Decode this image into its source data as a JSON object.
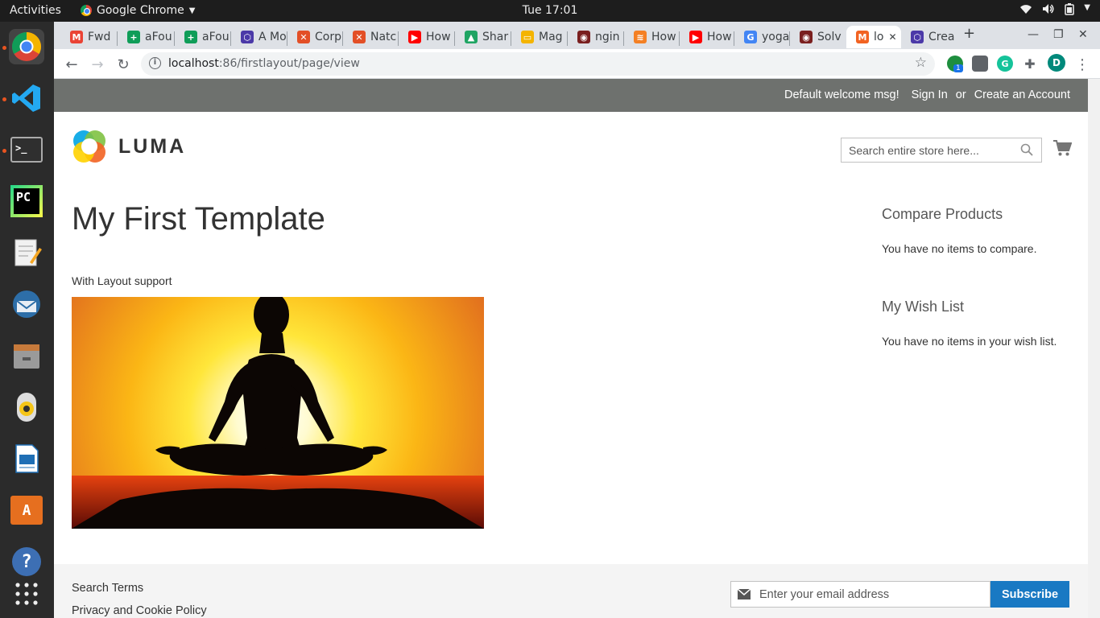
{
  "system": {
    "activities": "Activities",
    "app_name": "Google Chrome",
    "clock": "Tue 17:01"
  },
  "dock": [
    {
      "name": "chrome",
      "label": "",
      "color": "#4285f4"
    },
    {
      "name": "vscode",
      "label": "",
      "color": "#23a9f2"
    },
    {
      "name": "terminal",
      "label": ">_",
      "color": "#2f2f2f"
    },
    {
      "name": "pycharm",
      "label": "PC",
      "color": "#21d789"
    },
    {
      "name": "text-editor",
      "label": "",
      "color": "#f1f1f1"
    },
    {
      "name": "thunderbird",
      "label": "",
      "color": "#2d6ea8"
    },
    {
      "name": "files",
      "label": "",
      "color": "#9a9a9a"
    },
    {
      "name": "rhythmbox",
      "label": "",
      "color": "#f5c518"
    },
    {
      "name": "writer",
      "label": "",
      "color": "#1f6fb5"
    },
    {
      "name": "software",
      "label": "A",
      "color": "#e66f1f"
    },
    {
      "name": "help",
      "label": "?",
      "color": "#3d6fb4"
    }
  ],
  "tabs": [
    {
      "title": "Fwd",
      "fav": "M",
      "color": "#ea4335"
    },
    {
      "title": "aFou",
      "fav": "+",
      "color": "#0f9d58"
    },
    {
      "title": "aFou",
      "fav": "+",
      "color": "#0f9d58"
    },
    {
      "title": "A Mo",
      "fav": "⬡",
      "color": "#4b39a8"
    },
    {
      "title": "Corp",
      "fav": "✕",
      "color": "#e34f26"
    },
    {
      "title": "Natc",
      "fav": "✕",
      "color": "#e34f26"
    },
    {
      "title": "How",
      "fav": "▶",
      "color": "#ff0000"
    },
    {
      "title": "Shar",
      "fav": "▲",
      "color": "#1fa463"
    },
    {
      "title": "Mag",
      "fav": "▭",
      "color": "#f4b400"
    },
    {
      "title": "ngin",
      "fav": "◉",
      "color": "#7a1f1f"
    },
    {
      "title": "How",
      "fav": "≋",
      "color": "#f48024"
    },
    {
      "title": "How",
      "fav": "▶",
      "color": "#ff0000"
    },
    {
      "title": "yoga",
      "fav": "G",
      "color": "#4285f4"
    },
    {
      "title": "Solv",
      "fav": "◉",
      "color": "#7a1f1f"
    },
    {
      "title": "lo",
      "fav": "M",
      "color": "#f26322"
    },
    {
      "title": "Crea",
      "fav": "⬡",
      "color": "#4b39a8"
    }
  ],
  "toolbar": {
    "url_host": "localhost",
    "url_rest": ":86/firstlayout/page/view",
    "profile_initial": "D",
    "ext_badge": "1"
  },
  "header": {
    "welcome": "Default welcome msg!",
    "sign_in": "Sign In",
    "or": "or",
    "create_account": "Create an Account",
    "logo_text": "LUMA",
    "search_placeholder": "Search entire store here..."
  },
  "main": {
    "title": "My First Template",
    "subtitle": "With Layout support"
  },
  "sidebar": {
    "compare_title": "Compare Products",
    "compare_text": "You have no items to compare.",
    "wishlist_title": "My Wish List",
    "wishlist_text": "You have no items in your wish list."
  },
  "footer": {
    "links": [
      "Search Terms",
      "Privacy and Cookie Policy"
    ],
    "email_placeholder": "Enter your email address",
    "subscribe": "Subscribe"
  },
  "colors": {
    "panel_header": "#6e716e",
    "accent": "#1979c3",
    "footer_bg": "#f4f4f4"
  }
}
